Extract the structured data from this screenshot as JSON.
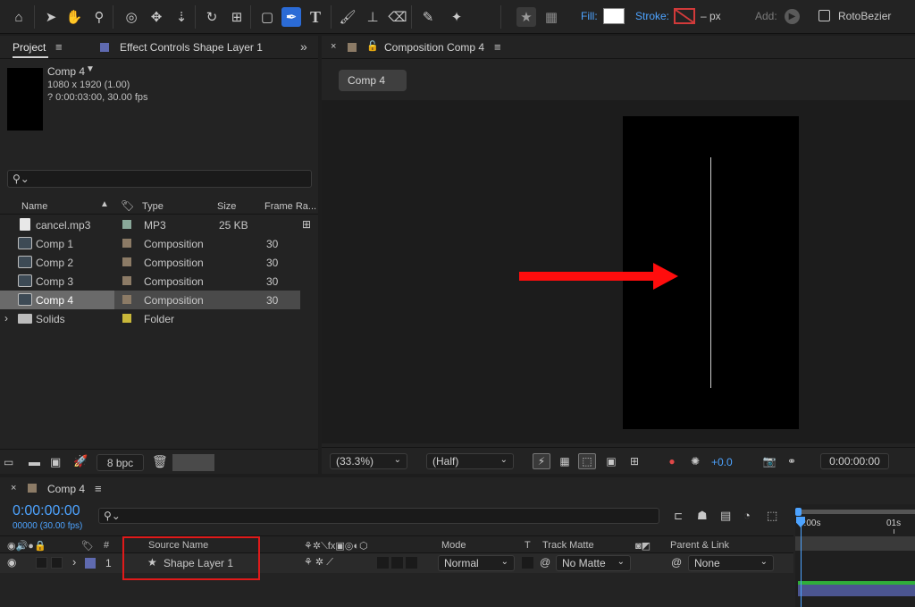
{
  "toolbar": {
    "fill_label": "Fill:",
    "stroke_label": "Stroke:",
    "stroke_px": "– px",
    "add_label": "Add:",
    "rotobezier_label": "RotoBezier",
    "colors": {
      "fill": "#ffffff",
      "accent": "#4da3ff",
      "active_tool": "#2b6bd6"
    }
  },
  "project_panel": {
    "tab_project": "Project",
    "tab_effect_controls": "Effect Controls Shape Layer 1",
    "comp_name": "Comp 4",
    "comp_dims": "1080 x 1920 (1.00)",
    "comp_duration": "? 0:00:03:00, 30.00 fps",
    "columns": {
      "name": "Name",
      "type": "Type",
      "size": "Size",
      "frame_rate": "Frame Ra..."
    },
    "items": [
      {
        "name": "cancel.mp3",
        "type": "MP3",
        "size": "25 KB",
        "fps": "",
        "label_color": "#8aa89a",
        "icon": "audio-file-icon"
      },
      {
        "name": "Comp 1",
        "type": "Composition",
        "size": "",
        "fps": "30",
        "label_color": "#8c7b66",
        "icon": "composition-icon"
      },
      {
        "name": "Comp 2",
        "type": "Composition",
        "size": "",
        "fps": "30",
        "label_color": "#8c7b66",
        "icon": "composition-icon"
      },
      {
        "name": "Comp 3",
        "type": "Composition",
        "size": "",
        "fps": "30",
        "label_color": "#8c7b66",
        "icon": "composition-icon"
      },
      {
        "name": "Comp 4",
        "type": "Composition",
        "size": "",
        "fps": "30",
        "label_color": "#8c7b66",
        "icon": "composition-icon"
      },
      {
        "name": "Solids",
        "type": "Folder",
        "size": "",
        "fps": "",
        "label_color": "#c9b83a",
        "icon": "folder-icon"
      }
    ],
    "bpc": "8 bpc"
  },
  "composition_panel": {
    "tab_title": "Composition Comp 4",
    "breadcrumb": "Comp 4",
    "zoom": "(33.3%)",
    "resolution": "(Half)",
    "exposure": "+0.0",
    "timecode": "0:00:00:00"
  },
  "timeline": {
    "tab_title": "Comp 4",
    "timecode": "0:00:00:00",
    "frame_info": "00000 (30.00 fps)",
    "columns": {
      "number": "#",
      "source_name": "Source Name",
      "mode": "Mode",
      "t": "T",
      "track_matte": "Track Matte",
      "parent_link": "Parent & Link"
    },
    "layers": [
      {
        "number": "1",
        "name": "Shape Layer 1",
        "mode": "Normal",
        "track_matte": "No Matte",
        "parent": "None",
        "label_color": "#5f6ab0"
      }
    ],
    "ruler": {
      "start": "0:00s",
      "mark": "01s"
    }
  }
}
